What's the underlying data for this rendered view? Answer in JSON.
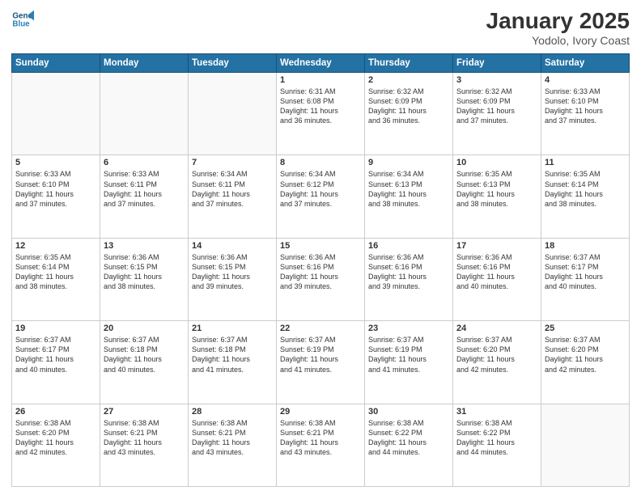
{
  "header": {
    "logo_general": "General",
    "logo_blue": "Blue",
    "month": "January 2025",
    "location": "Yodolo, Ivory Coast"
  },
  "weekdays": [
    "Sunday",
    "Monday",
    "Tuesday",
    "Wednesday",
    "Thursday",
    "Friday",
    "Saturday"
  ],
  "weeks": [
    [
      {
        "day": "",
        "info": ""
      },
      {
        "day": "",
        "info": ""
      },
      {
        "day": "",
        "info": ""
      },
      {
        "day": "1",
        "info": "Sunrise: 6:31 AM\nSunset: 6:08 PM\nDaylight: 11 hours\nand 36 minutes."
      },
      {
        "day": "2",
        "info": "Sunrise: 6:32 AM\nSunset: 6:09 PM\nDaylight: 11 hours\nand 36 minutes."
      },
      {
        "day": "3",
        "info": "Sunrise: 6:32 AM\nSunset: 6:09 PM\nDaylight: 11 hours\nand 37 minutes."
      },
      {
        "day": "4",
        "info": "Sunrise: 6:33 AM\nSunset: 6:10 PM\nDaylight: 11 hours\nand 37 minutes."
      }
    ],
    [
      {
        "day": "5",
        "info": "Sunrise: 6:33 AM\nSunset: 6:10 PM\nDaylight: 11 hours\nand 37 minutes."
      },
      {
        "day": "6",
        "info": "Sunrise: 6:33 AM\nSunset: 6:11 PM\nDaylight: 11 hours\nand 37 minutes."
      },
      {
        "day": "7",
        "info": "Sunrise: 6:34 AM\nSunset: 6:11 PM\nDaylight: 11 hours\nand 37 minutes."
      },
      {
        "day": "8",
        "info": "Sunrise: 6:34 AM\nSunset: 6:12 PM\nDaylight: 11 hours\nand 37 minutes."
      },
      {
        "day": "9",
        "info": "Sunrise: 6:34 AM\nSunset: 6:13 PM\nDaylight: 11 hours\nand 38 minutes."
      },
      {
        "day": "10",
        "info": "Sunrise: 6:35 AM\nSunset: 6:13 PM\nDaylight: 11 hours\nand 38 minutes."
      },
      {
        "day": "11",
        "info": "Sunrise: 6:35 AM\nSunset: 6:14 PM\nDaylight: 11 hours\nand 38 minutes."
      }
    ],
    [
      {
        "day": "12",
        "info": "Sunrise: 6:35 AM\nSunset: 6:14 PM\nDaylight: 11 hours\nand 38 minutes."
      },
      {
        "day": "13",
        "info": "Sunrise: 6:36 AM\nSunset: 6:15 PM\nDaylight: 11 hours\nand 38 minutes."
      },
      {
        "day": "14",
        "info": "Sunrise: 6:36 AM\nSunset: 6:15 PM\nDaylight: 11 hours\nand 39 minutes."
      },
      {
        "day": "15",
        "info": "Sunrise: 6:36 AM\nSunset: 6:16 PM\nDaylight: 11 hours\nand 39 minutes."
      },
      {
        "day": "16",
        "info": "Sunrise: 6:36 AM\nSunset: 6:16 PM\nDaylight: 11 hours\nand 39 minutes."
      },
      {
        "day": "17",
        "info": "Sunrise: 6:36 AM\nSunset: 6:16 PM\nDaylight: 11 hours\nand 40 minutes."
      },
      {
        "day": "18",
        "info": "Sunrise: 6:37 AM\nSunset: 6:17 PM\nDaylight: 11 hours\nand 40 minutes."
      }
    ],
    [
      {
        "day": "19",
        "info": "Sunrise: 6:37 AM\nSunset: 6:17 PM\nDaylight: 11 hours\nand 40 minutes."
      },
      {
        "day": "20",
        "info": "Sunrise: 6:37 AM\nSunset: 6:18 PM\nDaylight: 11 hours\nand 40 minutes."
      },
      {
        "day": "21",
        "info": "Sunrise: 6:37 AM\nSunset: 6:18 PM\nDaylight: 11 hours\nand 41 minutes."
      },
      {
        "day": "22",
        "info": "Sunrise: 6:37 AM\nSunset: 6:19 PM\nDaylight: 11 hours\nand 41 minutes."
      },
      {
        "day": "23",
        "info": "Sunrise: 6:37 AM\nSunset: 6:19 PM\nDaylight: 11 hours\nand 41 minutes."
      },
      {
        "day": "24",
        "info": "Sunrise: 6:37 AM\nSunset: 6:20 PM\nDaylight: 11 hours\nand 42 minutes."
      },
      {
        "day": "25",
        "info": "Sunrise: 6:37 AM\nSunset: 6:20 PM\nDaylight: 11 hours\nand 42 minutes."
      }
    ],
    [
      {
        "day": "26",
        "info": "Sunrise: 6:38 AM\nSunset: 6:20 PM\nDaylight: 11 hours\nand 42 minutes."
      },
      {
        "day": "27",
        "info": "Sunrise: 6:38 AM\nSunset: 6:21 PM\nDaylight: 11 hours\nand 43 minutes."
      },
      {
        "day": "28",
        "info": "Sunrise: 6:38 AM\nSunset: 6:21 PM\nDaylight: 11 hours\nand 43 minutes."
      },
      {
        "day": "29",
        "info": "Sunrise: 6:38 AM\nSunset: 6:21 PM\nDaylight: 11 hours\nand 43 minutes."
      },
      {
        "day": "30",
        "info": "Sunrise: 6:38 AM\nSunset: 6:22 PM\nDaylight: 11 hours\nand 44 minutes."
      },
      {
        "day": "31",
        "info": "Sunrise: 6:38 AM\nSunset: 6:22 PM\nDaylight: 11 hours\nand 44 minutes."
      },
      {
        "day": "",
        "info": ""
      }
    ]
  ]
}
